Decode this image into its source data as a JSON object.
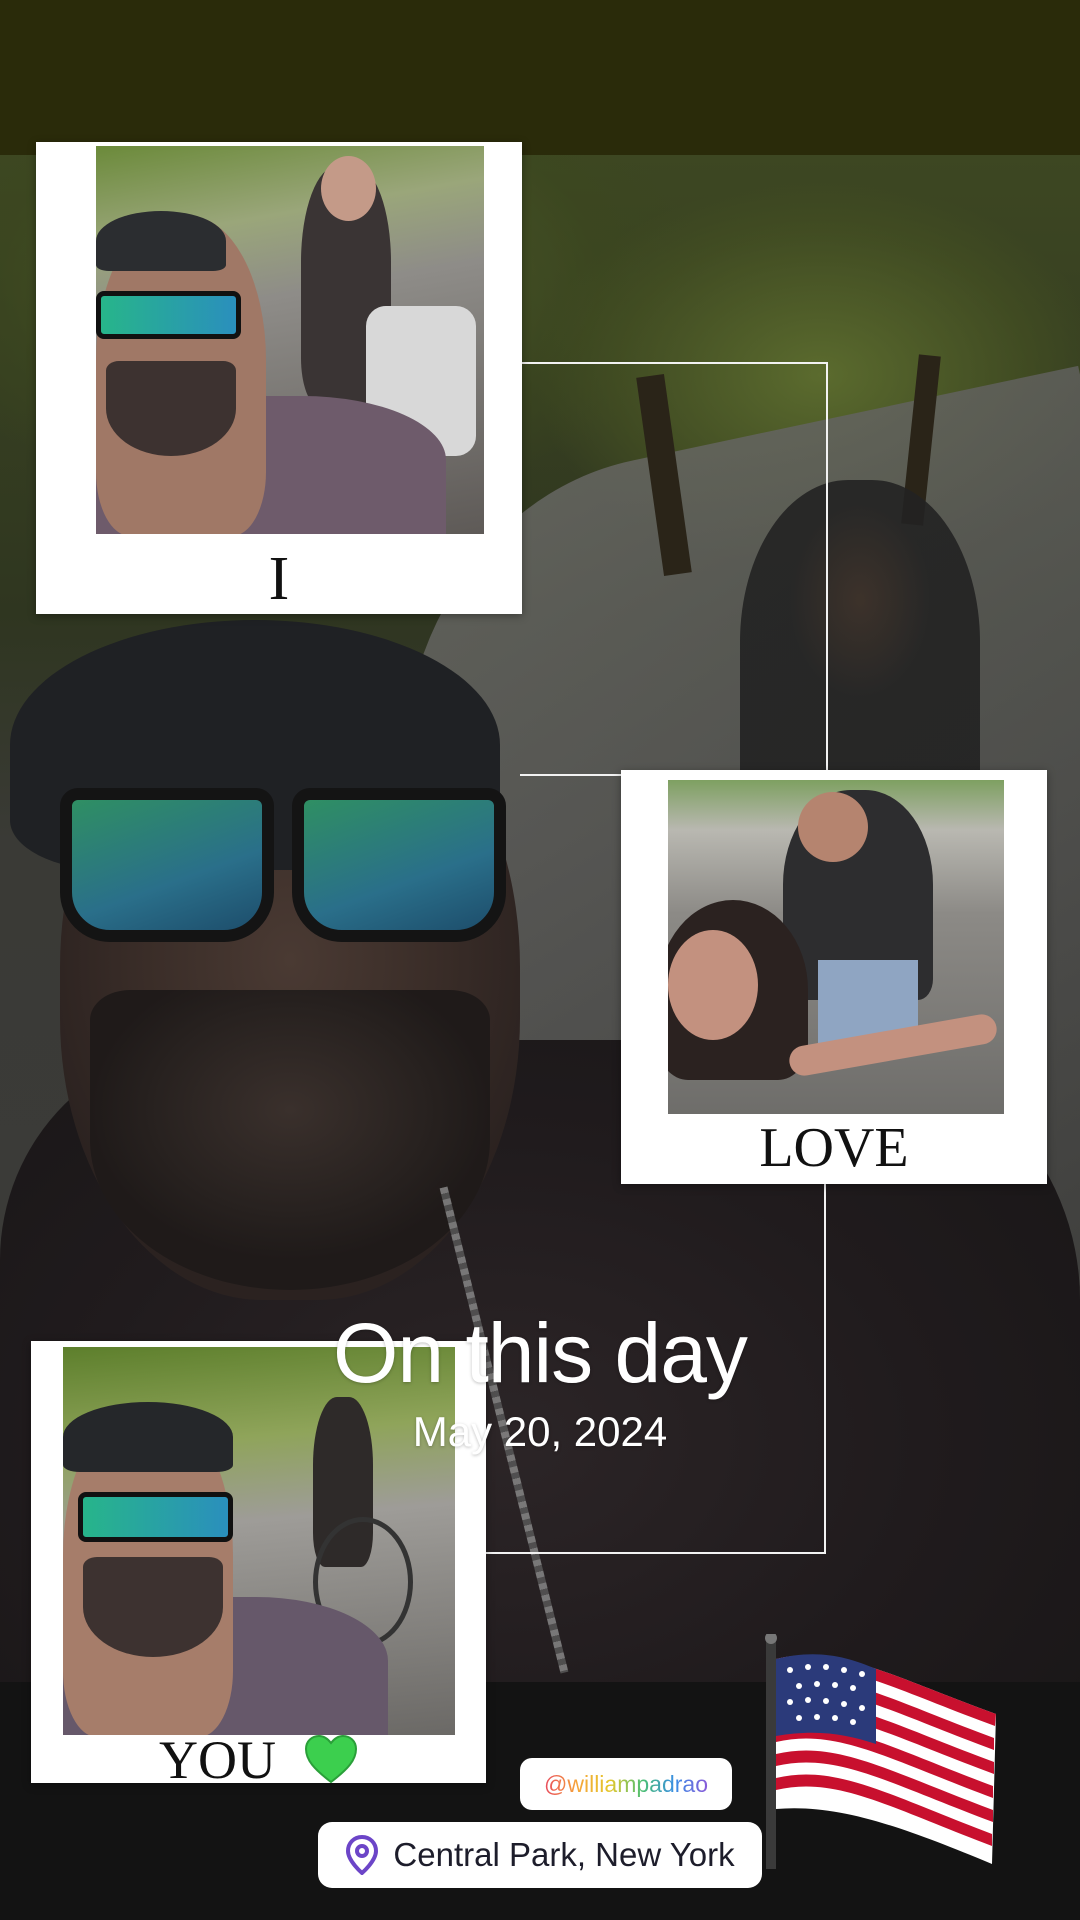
{
  "captions": {
    "photo1": "I",
    "photo2": "LOVE",
    "photo3": "YOU",
    "photo3_emoji": "💚"
  },
  "overlay": {
    "title": "On this day",
    "date": "May 20, 2024"
  },
  "stickers": {
    "handle": "@williampadrao",
    "location": "Central Park, New York",
    "flag_icon": "us-flag-icon",
    "pin_icon": "location-pin-icon"
  },
  "colors": {
    "top_bar": "#2a2b0a",
    "bottom_bar": "#131313",
    "polaroid": "#ffffff",
    "pin": "#6c45c8",
    "heart": "#3ccf4e"
  }
}
